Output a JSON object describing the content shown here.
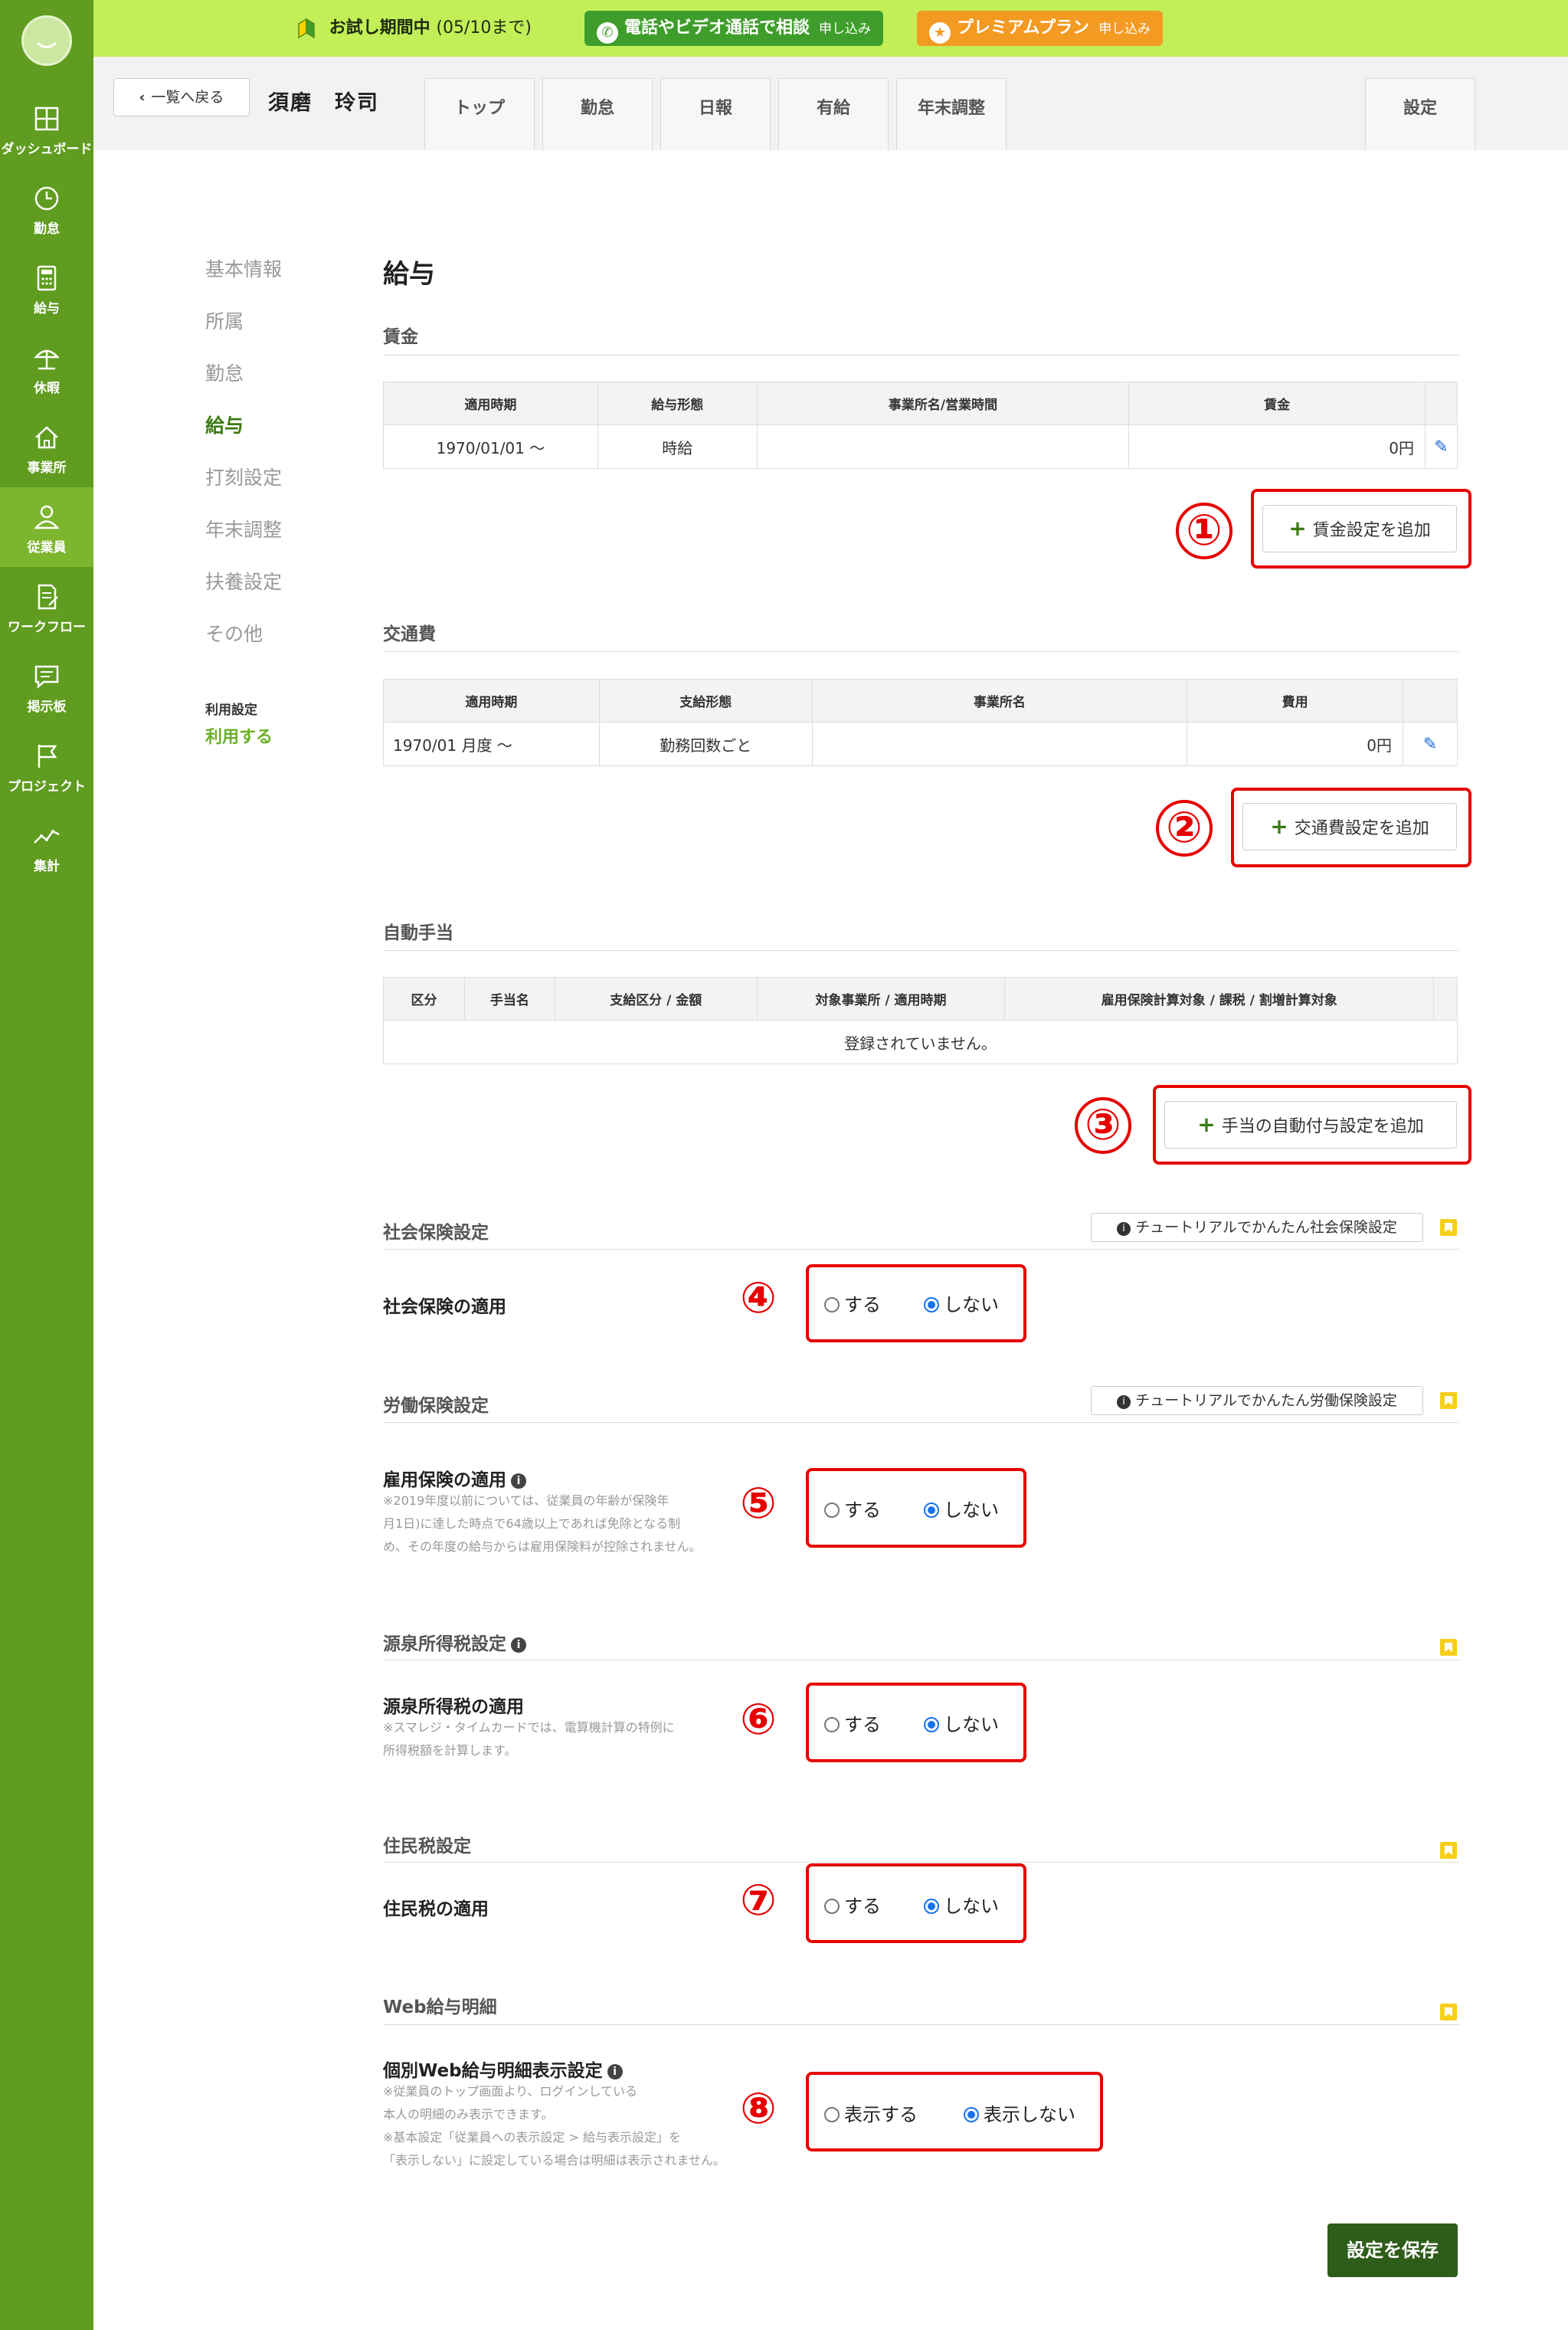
{
  "sidebar": {
    "items": [
      {
        "label": "ダッシュボード",
        "icon": "dashboard-icon"
      },
      {
        "label": "勤怠",
        "icon": "clock-icon"
      },
      {
        "label": "給与",
        "icon": "calculator-icon"
      },
      {
        "label": "休暇",
        "icon": "beach-icon"
      },
      {
        "label": "事業所",
        "icon": "home-icon"
      },
      {
        "label": "従業員",
        "icon": "person-icon"
      },
      {
        "label": "ワークフロー",
        "icon": "document-edit-icon"
      },
      {
        "label": "掲示板",
        "icon": "chat-icon"
      },
      {
        "label": "プロジェクト",
        "icon": "flag-icon"
      },
      {
        "label": "集計",
        "icon": "chart-line-icon"
      }
    ]
  },
  "banner": {
    "trial_label": "お試し期間中",
    "trial_until": "(05/10まで)",
    "consult_label": "電話やビデオ通話で相談",
    "consult_apply": "申し込み",
    "premium_label": "プレミアムプラン",
    "premium_apply": "申し込み"
  },
  "header": {
    "back_label": "一覧へ戻る",
    "employee_name": "須磨　玲司",
    "tabs": [
      "トップ",
      "勤怠",
      "日報",
      "有給",
      "年末調整"
    ],
    "settings_tab": "設定"
  },
  "subnav": {
    "items": [
      "基本情報",
      "所属",
      "勤怠",
      "給与",
      "打刻設定",
      "年末調整",
      "扶養設定",
      "その他"
    ],
    "usage_label": "利用設定",
    "usage_value": "利用する"
  },
  "page_title": "給与",
  "wage": {
    "title": "賃金",
    "headers": [
      "適用時期",
      "給与形態",
      "事業所名/営業時間",
      "賃金"
    ],
    "rows": [
      {
        "period": "1970/01/01 〜",
        "type": "時給",
        "office": "",
        "amount": "0円"
      }
    ],
    "add_label": "賃金設定を追加",
    "marker": "①"
  },
  "transport": {
    "title": "交通費",
    "headers": [
      "適用時期",
      "支給形態",
      "事業所名",
      "費用"
    ],
    "rows": [
      {
        "period": "1970/01 月度 〜",
        "type": "勤務回数ごと",
        "office": "",
        "amount": "0円"
      }
    ],
    "add_label": "交通費設定を追加",
    "marker": "②"
  },
  "allowance": {
    "title": "自動手当",
    "headers": [
      "区分",
      "手当名",
      "支給区分 / 金額",
      "対象事業所 / 適用時期",
      "雇用保険計算対象 / 課税 / 割増計算対象"
    ],
    "empty": "登録されていません。",
    "add_label": "手当の自動付与設定を追加",
    "marker": "③"
  },
  "social_insurance": {
    "title": "社会保険設定",
    "tutorial": "チュートリアルでかんたん社会保険設定",
    "field": "社会保険の適用",
    "opt_yes": "する",
    "opt_no": "しない",
    "marker": "④"
  },
  "labor_insurance": {
    "title": "労働保険設定",
    "tutorial": "チュートリアルでかんたん労働保険設定",
    "field": "雇用保険の適用",
    "note1": "※2019年度以前については、従業員の年齢が保険年",
    "note2": "月1日)に達した時点で64歳以上であれば免除となる制",
    "note3": "め、その年度の給与からは雇用保険料が控除されません。",
    "opt_yes": "する",
    "opt_no": "しない",
    "marker": "⑤"
  },
  "income_tax": {
    "title": "源泉所得税設定",
    "field": "源泉所得税の適用",
    "note1": "※スマレジ・タイムカードでは、電算機計算の特例に",
    "note2": "所得税額を計算します。",
    "opt_yes": "する",
    "opt_no": "しない",
    "marker": "⑥"
  },
  "resident_tax": {
    "title": "住民税設定",
    "field": "住民税の適用",
    "opt_yes": "する",
    "opt_no": "しない",
    "marker": "⑦"
  },
  "web_payslip": {
    "title": "Web給与明細",
    "field": "個別Web給与明細表示設定",
    "note1": "※従業員のトップ画面より、ログインしている",
    "note2": "本人の明細のみ表示できます。",
    "note3": "※基本設定「従業員への表示設定 > 給与表示設定」を",
    "note4": "「表示しない」に設定している場合は明細は表示されません。",
    "opt_yes": "表示する",
    "opt_no": "表示しない",
    "marker": "⑧"
  },
  "save_label": "設定を保存",
  "colors": {
    "sidebar": "#5f9c1f",
    "banner": "#c2ef57",
    "accent_green": "#3c7a12",
    "highlight_red": "#e60000",
    "radio_blue": "#1a73e8"
  }
}
